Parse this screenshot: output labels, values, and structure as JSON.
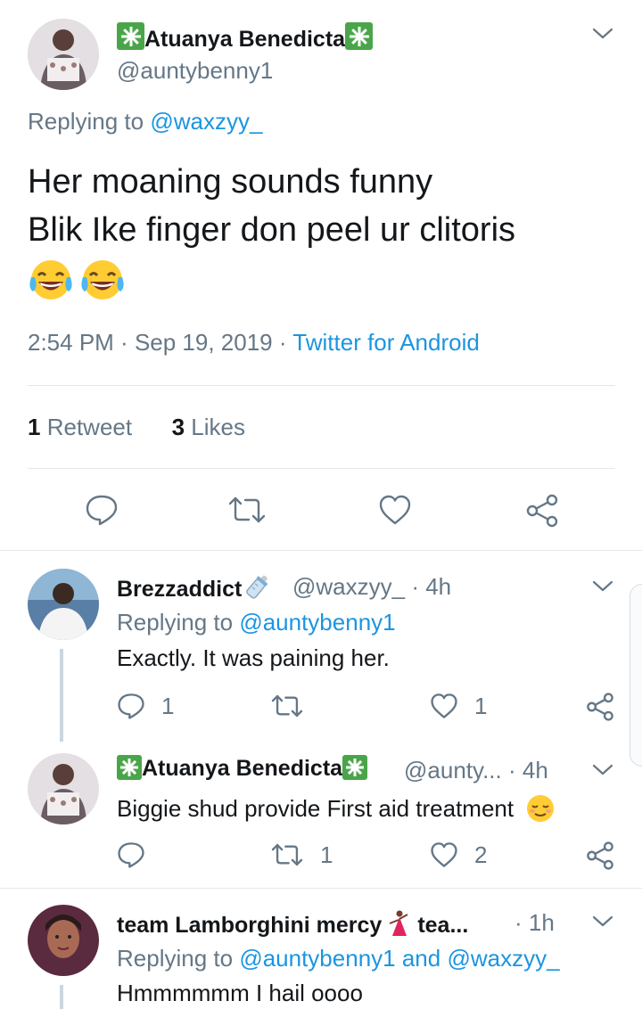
{
  "main_tweet": {
    "display_name": "Atuanya Benedicta",
    "handle": "@auntybenny1",
    "replying_prefix": "Replying to",
    "replying_to": "@waxzyy_",
    "text_line1": "Her moaning sounds funny",
    "text_line2": "Blik Ike finger don peel ur clitoris",
    "emoji": "face-with-tears-of-joy",
    "time": "2:54 PM",
    "date": "Sep 19, 2019",
    "source": "Twitter for Android",
    "retweet_count": "1",
    "retweet_label": "Retweet",
    "like_count": "3",
    "like_label": "Likes"
  },
  "replies": [
    {
      "display_name": "Brezzaddict",
      "badge_emoji": "baby-bottle",
      "handle": "@waxzyy_",
      "age": "4h",
      "replying_prefix": "Replying to",
      "replying_to": "@auntybenny1",
      "text": "Exactly. It was paining her.",
      "reply_count": "1",
      "retweet_count": "",
      "like_count": "1"
    },
    {
      "display_name": "Atuanya Benedicta",
      "handle": "@aunty...",
      "age": "4h",
      "text": "Biggie shud provide First aid treatment",
      "text_emoji": "relieved-face",
      "reply_count": "",
      "retweet_count": "1",
      "like_count": "2"
    },
    {
      "display_name": "team Lamborghini mercy",
      "badge_emoji": "dancer",
      "name_suffix": "tea...",
      "age": "1h",
      "replying_prefix": "Replying to",
      "replying_to_1": "@auntybenny1",
      "replying_and": "and",
      "replying_to_2": "@waxzyy_",
      "text": "Hmmmmmm I hail oooo"
    }
  ],
  "colors": {
    "accent": "#1b95e0",
    "secondary_text": "#657786",
    "primary_text": "#14171a",
    "divider": "#e1e8ed",
    "thread_line": "#ccd6dd",
    "badge_green": "#4aa54a"
  }
}
